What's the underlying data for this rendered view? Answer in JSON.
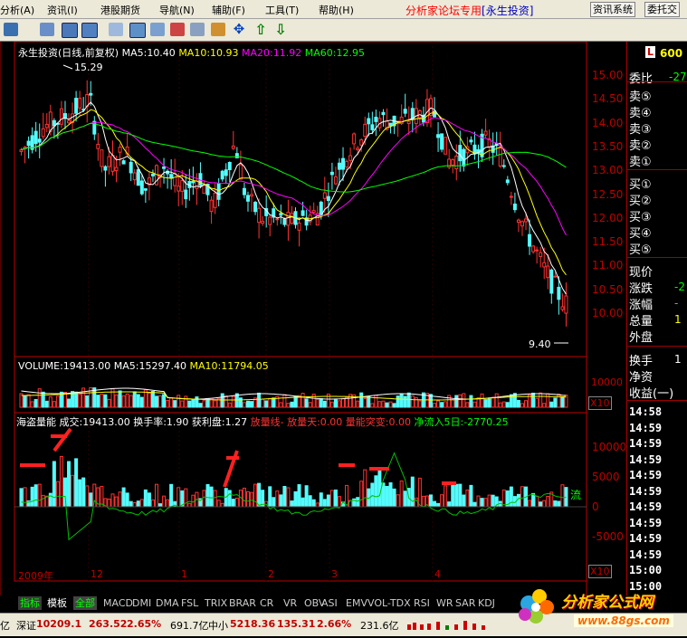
{
  "menu": {
    "items": [
      "分析(A)",
      "资讯(I)",
      "港股期货",
      "导航(N)",
      "辅助(F)",
      "工具(T)",
      "帮助(H)"
    ],
    "forum_title": "分析家论坛专用",
    "forum_bracket": "[永生投资]",
    "btn_news": "资讯系统",
    "btn_trade": "委托交"
  },
  "toolbar": {
    "icons": [
      "kline-icon",
      "chart-icon",
      "bsi-icon",
      "ert-icon",
      "wave-icon",
      "chain-icon",
      "pencil-icon",
      "move-icon",
      "up-arrow-icon",
      "down-arrow-icon"
    ]
  },
  "chart": {
    "title_stock": "永生投资(日线,前复权)",
    "ma5": "MA5:10.40",
    "ma10": "MA10:10.93",
    "ma20": "MA20:11.92",
    "ma60": "MA60:12.95",
    "high_mark": "15.29",
    "low_mark": "9.40",
    "price_ticks": [
      "15.00",
      "14.50",
      "14.00",
      "13.50",
      "13.00",
      "12.50",
      "12.00",
      "11.50",
      "11.00",
      "10.50",
      "10.00"
    ],
    "volume_line": "VOLUME:19413.00",
    "vol_ma5": "MA5:15297.40",
    "vol_ma10": "MA10:11794.05",
    "vol_tick": "10000",
    "x10": "X10",
    "ind_name": "海盗量能",
    "ind_vol": "成交:19413.00",
    "ind_turn": "换手率:1.90",
    "ind_profit": "获利盘:1.27",
    "ind_lianglian": "放量线-",
    "ind_fangliangtian": "放量天:0.00",
    "ind_tupo": "量能突变:0.00",
    "ind_jingliu": "净流入5日:-2770.25",
    "ind_ticks": [
      "10000",
      "5000",
      "0",
      "-5000"
    ],
    "ind_liu": "流",
    "x_labels": [
      "2009年",
      "12",
      "1",
      "2",
      "3",
      "4"
    ],
    "chart_data": {
      "type": "candlestick",
      "price_range": [
        9.4,
        15.29
      ]
    }
  },
  "rightpanel": {
    "badge": "L",
    "code": "600",
    "weibi": "委比",
    "weibi_val": "-27",
    "sells": [
      "卖⑤",
      "卖④",
      "卖③",
      "卖②",
      "卖①"
    ],
    "buys": [
      "买①",
      "买②",
      "买③",
      "买④",
      "买⑤"
    ],
    "labels": [
      "现价",
      "涨跌",
      "涨幅",
      "总量",
      "外盘"
    ],
    "label_vals": [
      "",
      "-2",
      "-",
      "1",
      ""
    ],
    "labels2": [
      "换手",
      "净资",
      "收益(一)"
    ],
    "label2_vals": [
      "1",
      "",
      ""
    ],
    "times": [
      "14:58",
      "14:59",
      "14:59",
      "14:59",
      "14:59",
      "14:59",
      "14:59",
      "14:59",
      "14:59",
      "14:59",
      "15:00",
      "15:00"
    ]
  },
  "tabs": [
    "指标",
    "模板",
    "全部",
    "MACD",
    "DMI",
    "DMA",
    "FSL",
    "TRIX",
    "BRAR",
    "CR",
    "VR",
    "OBV",
    "ASI",
    "EMV",
    "VOL-TDX",
    "RSI",
    "WR",
    "SAR",
    "KDJ"
  ],
  "status": {
    "frag": "亿",
    "sz_label": "深证",
    "sz_val": "10209.1",
    "sz_chg": "263.52",
    "sz_pct": "2.65%",
    "sz_amt": "691.7亿",
    "zx_label": "中小",
    "zx_val": "5218.36",
    "zx_chg": "135.31",
    "zx_pct": "2.66%",
    "zx_amt": "231.6亿"
  },
  "logo": {
    "text": "分析家公式网",
    "url": "www.88gs.com"
  },
  "colors": {
    "up": "#ff3232",
    "down": "#54fcfc",
    "ma5": "#ffffff",
    "ma10": "#ffff00",
    "ma20": "#ff00ff",
    "ma60": "#00ff00"
  }
}
